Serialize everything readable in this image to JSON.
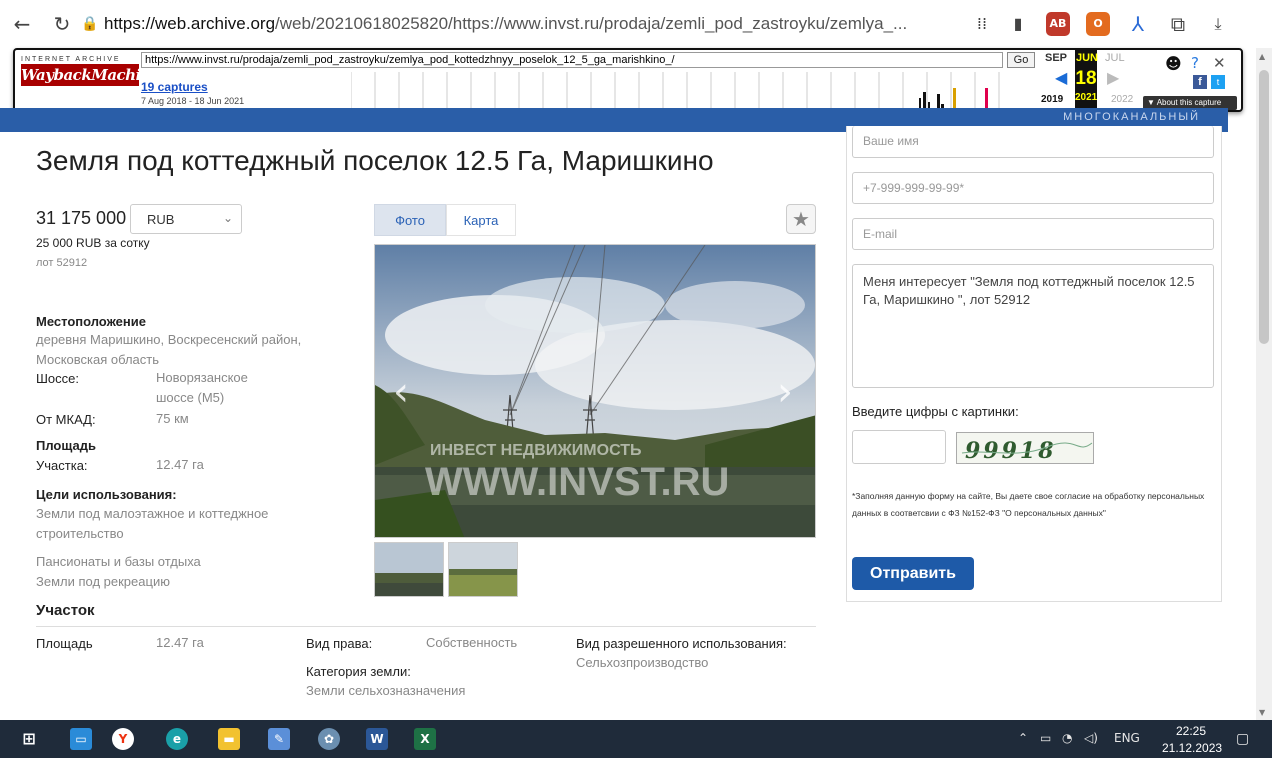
{
  "browser": {
    "url_host": "https://web.archive.org",
    "url_path": "/web/20210618025820/https://www.invst.ru/prodaja/zemli_pod_zastroyku/zemlya_..."
  },
  "wayback": {
    "logo_top": "INTERNET ARCHIVE",
    "logo": "WaybackMachine",
    "url": "https://www.invst.ru/prodaja/zemli_pod_zastroyku/zemlya_pod_kottedzhnyy_poselok_12_5_ga_marishkino_/",
    "go": "Go",
    "captures": "19 captures",
    "range": "7 Aug 2018 - 18 Jun 2021",
    "month_prev": "SEP",
    "month_cur": "JUN",
    "month_next": "JUL",
    "day": "18",
    "year_prev": "2019",
    "year_cur": "2021",
    "year_next": "2022",
    "about": "▼ About this capture"
  },
  "header": {
    "tagline": "МНОГОКАНАЛЬНЫЙ"
  },
  "listing": {
    "title": "Земля под коттеджный поселок 12.5 Га, Маришкино",
    "price": "31 175 000",
    "currency": "RUB",
    "price_per": "25 000 RUB  за сотку",
    "lot": "лот 52912",
    "location_label": "Местоположение",
    "location": "деревня Маришкино, Воскресенский район, Московская область",
    "highway_label": "Шоссе:",
    "highway": "Новорязанское шоссе (М5)",
    "mkad_label": "От МКАД:",
    "mkad": "75 км",
    "area_label": "Площадь",
    "plot_label": "Участка:",
    "plot": "12.47 га",
    "purpose_label": "Цели использования:",
    "purpose_1": "Земли под малоэтажное и коттеджное строительство",
    "purpose_2": "Пансионаты и базы отдыха",
    "purpose_3": "Земли под рекреацию",
    "section": "Участок",
    "d_area_label": "Площадь",
    "d_area": "12.47 га",
    "rights_label": "Вид права:",
    "rights": "Собственность",
    "category_label": "Категория земли:",
    "category": "Земли сельхозназначения",
    "usage_label": "Вид разрешенного использования:",
    "usage": "Сельхозпроизводство"
  },
  "gallery": {
    "tab_photo": "Фото",
    "tab_map": "Карта",
    "watermark_1": "ИНВЕСТ НЕДВИЖИМОСТЬ",
    "watermark_2": "WWW.INVST.RU"
  },
  "form": {
    "name_placeholder": "Ваше имя",
    "phone_placeholder": "+7-999-999-99-99*",
    "email_placeholder": "E-mail",
    "message": "Меня интересует \"Земля под коттеджный поселок 12.5 Га, Маришкино \", лот 52912",
    "captcha_label": "Введите цифры с картинки:",
    "captcha_code": "99918",
    "consent": "*Заполняя данную форму на сайте, Вы даете свое согласие на обработку персональных данных в соответсвии с ФЗ №152-ФЗ \"О персональных данных\"",
    "submit": "Отправить"
  },
  "taskbar": {
    "lang": "ENG",
    "time": "22:25",
    "date": "21.12.2023"
  }
}
